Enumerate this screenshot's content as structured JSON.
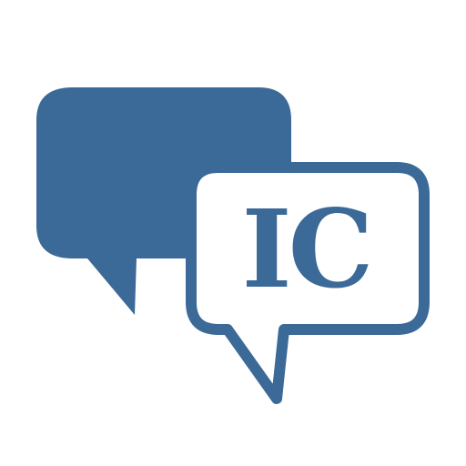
{
  "logo": {
    "monogram": "IC",
    "icon": "chat-bubbles-icon"
  },
  "colors": {
    "brand": "#3c6a98",
    "background": "#ffffff"
  }
}
